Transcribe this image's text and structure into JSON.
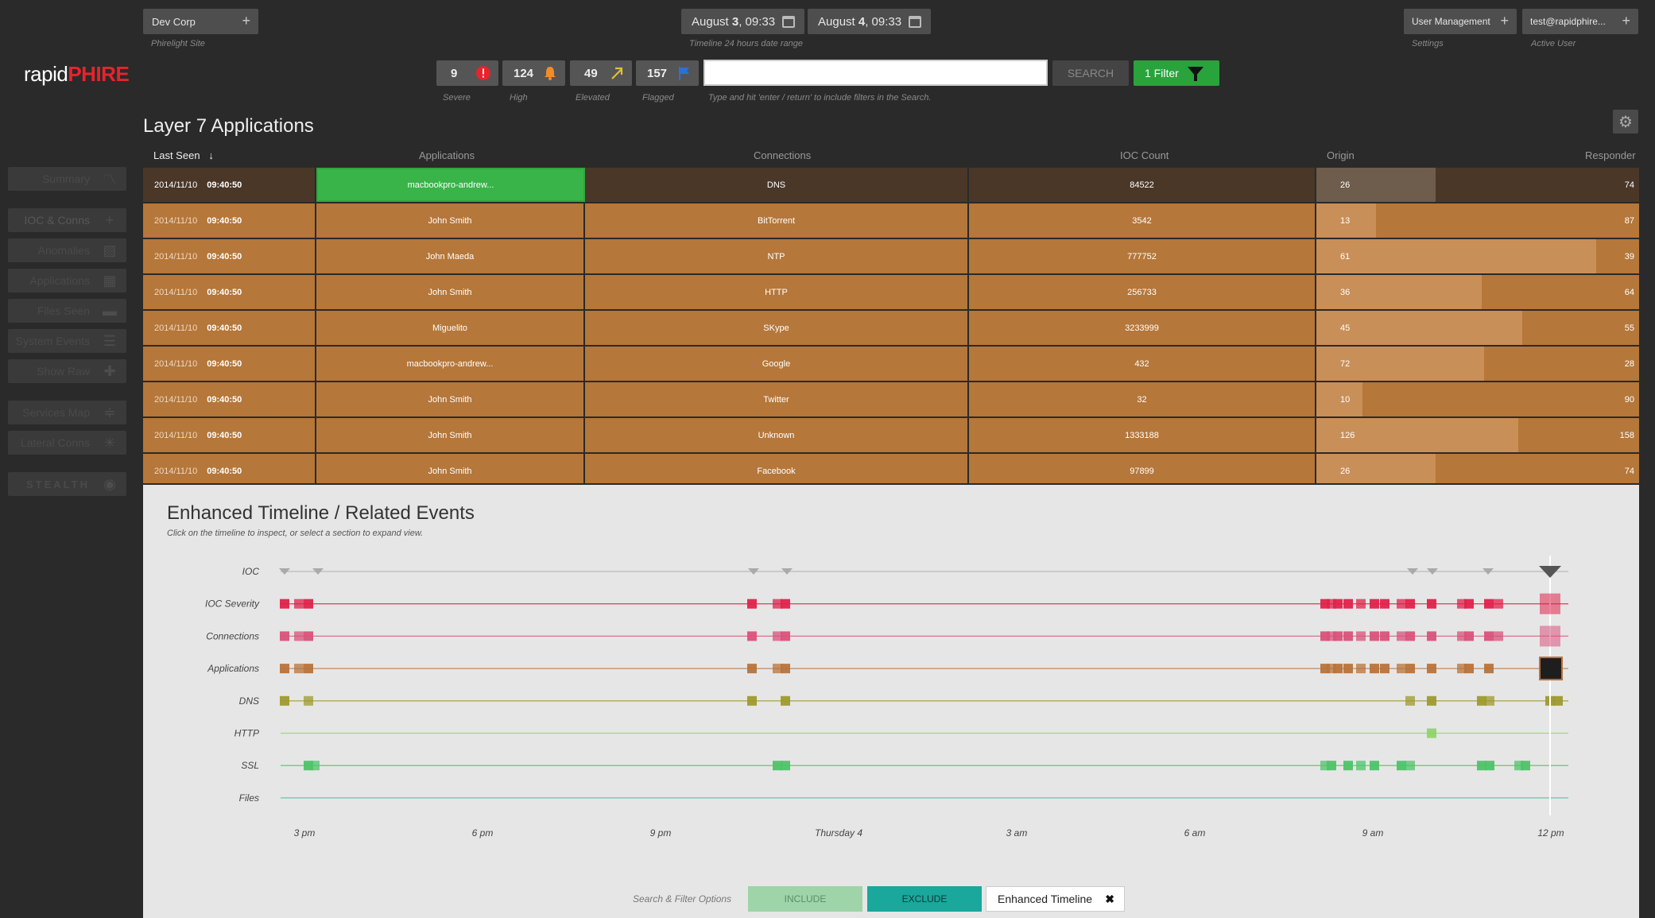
{
  "brand": {
    "prefix": "rapid",
    "suffix": "PHIRE"
  },
  "site": {
    "value": "Dev Corp",
    "label": "Phirelight Site"
  },
  "date_range": {
    "start": "August 3, 09:33",
    "start_day": "3",
    "end_day": "4",
    "start_month": "August",
    "start_time": ", 09:33",
    "end_month": "August",
    "end_time": ", 09:33",
    "label": "Timeline 24 hours date range"
  },
  "user_mgmt": {
    "value": "User Management",
    "label": "Settings"
  },
  "active_user": {
    "value": "test@rapidphire...",
    "label": "Active User"
  },
  "counters": [
    {
      "value": "9",
      "label": "Severe",
      "color": "#e8232b",
      "icon": "alert-icon"
    },
    {
      "value": "124",
      "label": "High",
      "color": "#f28c28",
      "icon": "bell-icon"
    },
    {
      "value": "49",
      "label": "Elevated",
      "color": "#e0c030",
      "icon": "arrow-up-right-icon"
    },
    {
      "value": "157",
      "label": "Flagged",
      "color": "#2d6fd6",
      "icon": "flag-icon"
    }
  ],
  "search": {
    "placeholder": "",
    "hint": "Type and hit 'enter / return' to include filters in the Search.",
    "button": "SEARCH",
    "filter_button": "1 Filter"
  },
  "sidebar": [
    {
      "label": "Summary",
      "icon": "trend-icon"
    },
    {
      "label": "IOC & Conns",
      "icon": "plus-icon"
    },
    {
      "label": "Anomalies",
      "icon": "image-icon"
    },
    {
      "label": "Applications",
      "icon": "grid-icon"
    },
    {
      "label": "Files Seen",
      "icon": "folder-icon"
    },
    {
      "label": "System Events",
      "icon": "list-icon"
    },
    {
      "label": "Show Raw",
      "icon": "puzzle-icon"
    },
    {
      "label": "Services Map",
      "icon": "sliders-icon"
    },
    {
      "label": "Lateral Conns",
      "icon": "network-icon"
    },
    {
      "label": "STEALTH",
      "icon": "shield-icon"
    }
  ],
  "table": {
    "title": "Layer 7 Applications",
    "columns": {
      "last_seen": "Last Seen",
      "applications": "Applications",
      "connections": "Connections",
      "ioc_count": "IOC Count",
      "origin": "Origin",
      "responder": "Responder"
    },
    "rows": [
      {
        "date": "2014/11/10",
        "time": "09:40:50",
        "application": "macbookpro-andrew...",
        "connection": "DNS",
        "ioc": "84522",
        "origin": "26",
        "responder": "74",
        "origin_frac": 0.26
      },
      {
        "date": "2014/11/10",
        "time": "09:40:50",
        "application": "John Smith",
        "connection": "BitTorrent",
        "ioc": "3542",
        "origin": "13",
        "responder": "87",
        "origin_frac": 0.13
      },
      {
        "date": "2014/11/10",
        "time": "09:40:50",
        "application": "John Maeda",
        "connection": "NTP",
        "ioc": "777752",
        "origin": "61",
        "responder": "39",
        "origin_frac": 0.61
      },
      {
        "date": "2014/11/10",
        "time": "09:40:50",
        "application": "John Smith",
        "connection": "HTTP",
        "ioc": "256733",
        "origin": "36",
        "responder": "64",
        "origin_frac": 0.36
      },
      {
        "date": "2014/11/10",
        "time": "09:40:50",
        "application": "Miguelito",
        "connection": "SKype",
        "ioc": "3233999",
        "origin": "45",
        "responder": "55",
        "origin_frac": 0.45
      },
      {
        "date": "2014/11/10",
        "time": "09:40:50",
        "application": "macbookpro-andrew...",
        "connection": "Google",
        "ioc": "432",
        "origin": "72",
        "responder": "28",
        "origin_frac": 0.72
      },
      {
        "date": "2014/11/10",
        "time": "09:40:50",
        "application": "John Smith",
        "connection": "Twitter",
        "ioc": "32",
        "origin": "10",
        "responder": "90",
        "origin_frac": 0.1
      },
      {
        "date": "2014/11/10",
        "time": "09:40:50",
        "application": "John Smith",
        "connection": "Unknown",
        "ioc": "1333188",
        "origin": "126",
        "responder": "158",
        "origin_frac": 0.44
      },
      {
        "date": "2014/11/10",
        "time": "09:40:50",
        "application": "John Smith",
        "connection": "Facebook",
        "ioc": "97899",
        "origin": "26",
        "responder": "74",
        "origin_frac": 0.26
      }
    ]
  },
  "timeline": {
    "title": "Enhanced Timeline / Related Events",
    "hint": "Click on the timeline to inspect, or select a section to expand view.",
    "lanes": [
      {
        "label": "IOC",
        "color": "#b0b0b0"
      },
      {
        "label": "IOC Severity",
        "color": "#e0224b"
      },
      {
        "label": "Connections",
        "color": "#d9527a"
      },
      {
        "label": "Applications",
        "color": "#b8733a"
      },
      {
        "label": "DNS",
        "color": "#9e9a2e"
      },
      {
        "label": "HTTP",
        "color": "#8fd46a"
      },
      {
        "label": "SSL",
        "color": "#4cc46a"
      },
      {
        "label": "Files",
        "color": "#3cc49a"
      }
    ],
    "x_ticks": [
      "3 pm",
      "6 pm",
      "9 pm",
      "Thursday 4",
      "3 am",
      "6 am",
      "9 am",
      "12 pm"
    ]
  },
  "filters": {
    "label": "Search & Filter Options",
    "include": "INCLUDE",
    "exclude": "EXCLUDE",
    "tag": "Enhanced Timeline"
  }
}
